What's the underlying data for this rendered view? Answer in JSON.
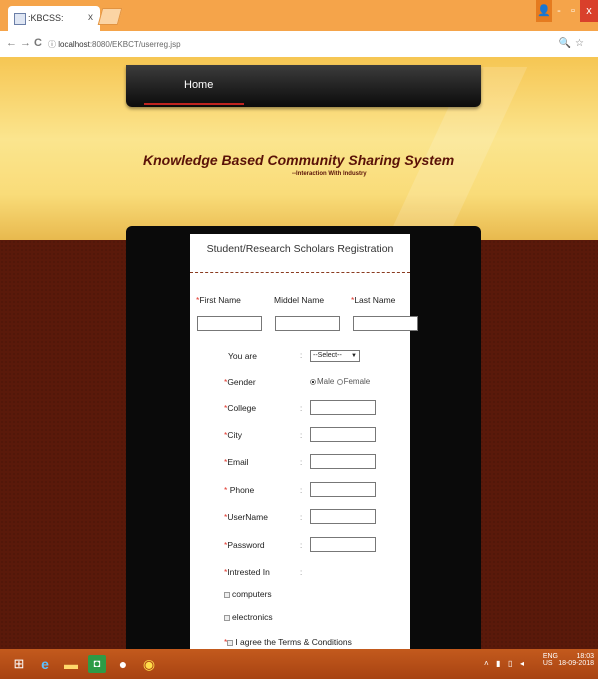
{
  "browser": {
    "tab_title": ":KBCSS:",
    "tab_close": "x",
    "url_host": "localhost",
    "url_rest": ":8080/EKBCT/userreg.jsp",
    "back_icon": "←",
    "forward_icon": "→",
    "reload_icon": "C",
    "info_icon": "ⓘ",
    "zoom_icon": "🔍",
    "star_icon": "☆",
    "window": {
      "user": "👤",
      "minimize": "-",
      "maximize": "▫",
      "close": "x"
    }
  },
  "navbar": {
    "home_label": "Home"
  },
  "header": {
    "title": "Knowledge Based Community Sharing System",
    "subtitle": "--Interaction With Industry"
  },
  "form": {
    "title": "Student/Research Scholars Registration",
    "required_mark": "*",
    "colon": ":",
    "first_name_label": "First Name",
    "middle_name_label": "Middel Name",
    "last_name_label": "Last Name",
    "you_are_label": "You are",
    "you_are_selected": "--Select--",
    "gender_label": "Gender",
    "gender_male": "Male",
    "gender_female": "Female",
    "college_label": "College",
    "city_label": "City",
    "email_label": "Email",
    "phone_label": "Phone",
    "username_label": "UserName",
    "password_label": "Password",
    "interested_label": "Intrested In",
    "interest_1": "computers",
    "interest_2": "electronics",
    "agree_label": "I agree the Terms & Conditions"
  },
  "taskbar": {
    "lang": "ENG",
    "region": "US",
    "time": "18:03",
    "date": "18-09-2018"
  }
}
